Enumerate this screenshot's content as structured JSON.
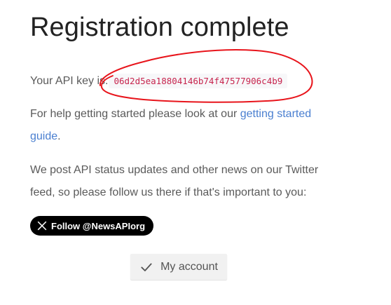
{
  "header": {
    "title": "Registration complete"
  },
  "api_key": {
    "label": "Your API key is:",
    "value": "06d2d5ea18804146b74f47577906c4b9"
  },
  "help": {
    "text_before": "For help getting started please look at our ",
    "link_text": "getting started guide",
    "text_after": "."
  },
  "news": {
    "text": "We post API status updates and other news on our Twitter feed, so please follow us there if that's important to you:"
  },
  "twitter_button": {
    "label": "Follow @NewsAPIorg",
    "icon": "x-logo-icon"
  },
  "account_button": {
    "label": "My account",
    "icon": "check-icon"
  },
  "colors": {
    "link": "#4a7fd0",
    "code_text": "#c7254e",
    "annotation": "#e8141b",
    "twitter_bg": "#000000"
  }
}
